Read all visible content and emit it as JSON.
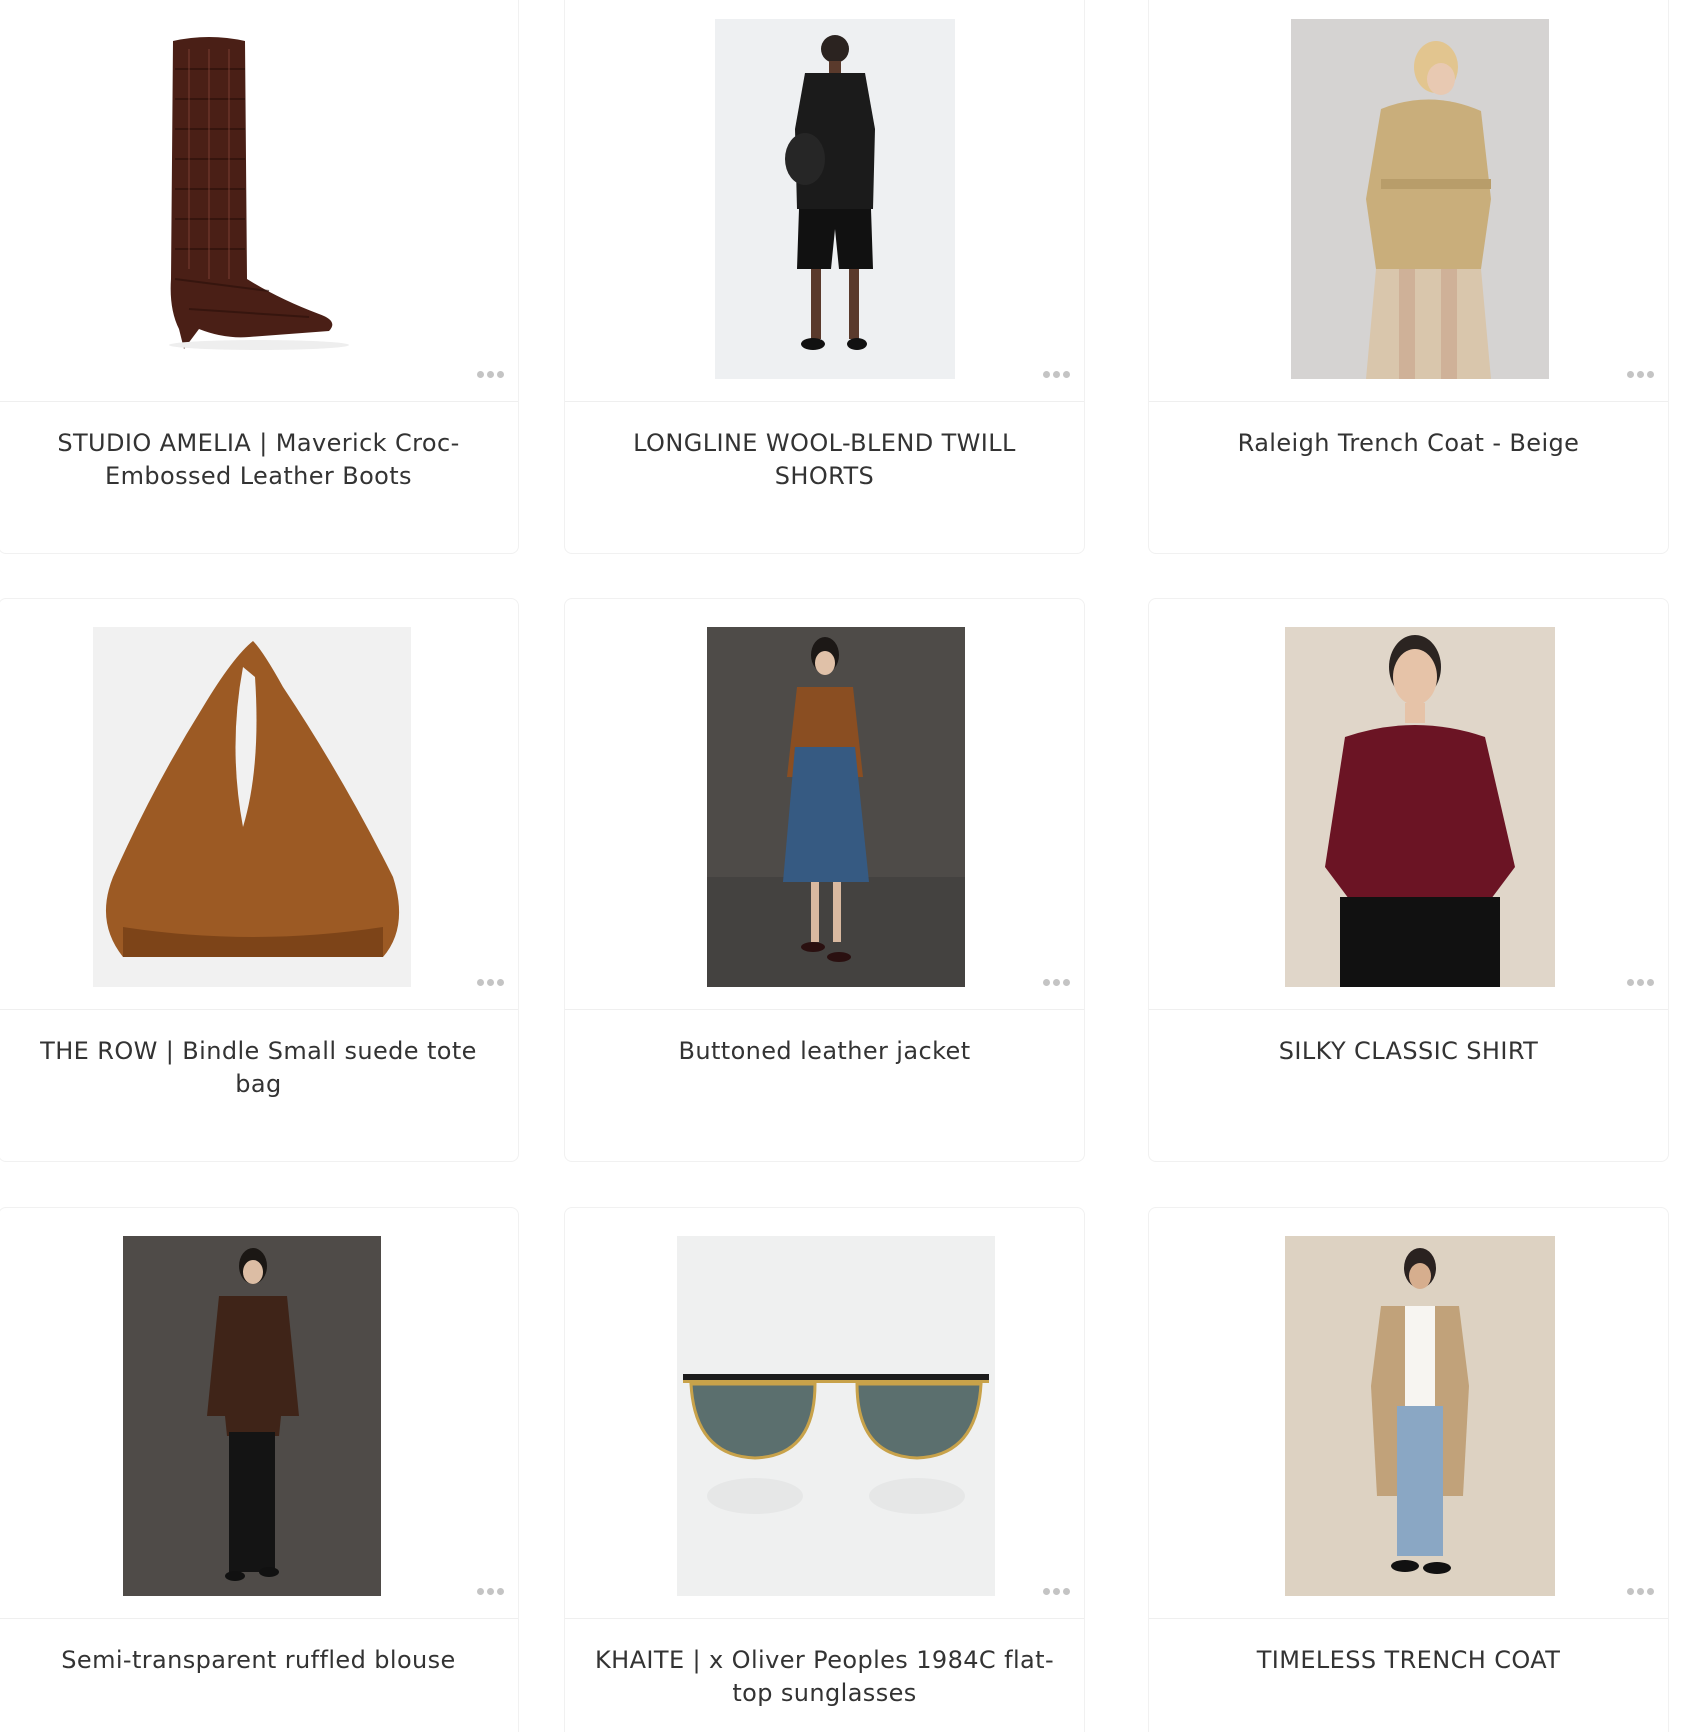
{
  "products": [
    {
      "title": "STUDIO AMELIA | Maverick Croc-Embossed Leather Boots",
      "image": "croc-leather-boot",
      "more_icon": "more-dots-icon"
    },
    {
      "title": "LONGLINE WOOL-BLEND TWILL SHORTS",
      "image": "model-black-shorts-vest",
      "more_icon": "more-dots-icon"
    },
    {
      "title": "Raleigh Trench Coat - Beige",
      "image": "model-beige-trench",
      "more_icon": "more-dots-icon"
    },
    {
      "title": "THE ROW | Bindle Small suede tote bag",
      "image": "suede-tote-bag",
      "more_icon": "more-dots-icon"
    },
    {
      "title": "Buttoned leather jacket",
      "image": "model-leather-jacket-denim-skirt",
      "more_icon": "more-dots-icon"
    },
    {
      "title": "SILKY CLASSIC SHIRT",
      "image": "model-burgundy-shirt",
      "more_icon": "more-dots-icon"
    },
    {
      "title": "Semi-transparent ruffled blouse",
      "image": "model-sheer-brown-blouse",
      "more_icon": "more-dots-icon"
    },
    {
      "title": "KHAITE | x Oliver Peoples 1984C flat-top sunglasses",
      "image": "flat-top-sunglasses",
      "more_icon": "more-dots-icon"
    },
    {
      "title": "TIMELESS TRENCH COAT",
      "image": "model-trench-coat-jeans",
      "more_icon": "more-dots-icon"
    }
  ]
}
